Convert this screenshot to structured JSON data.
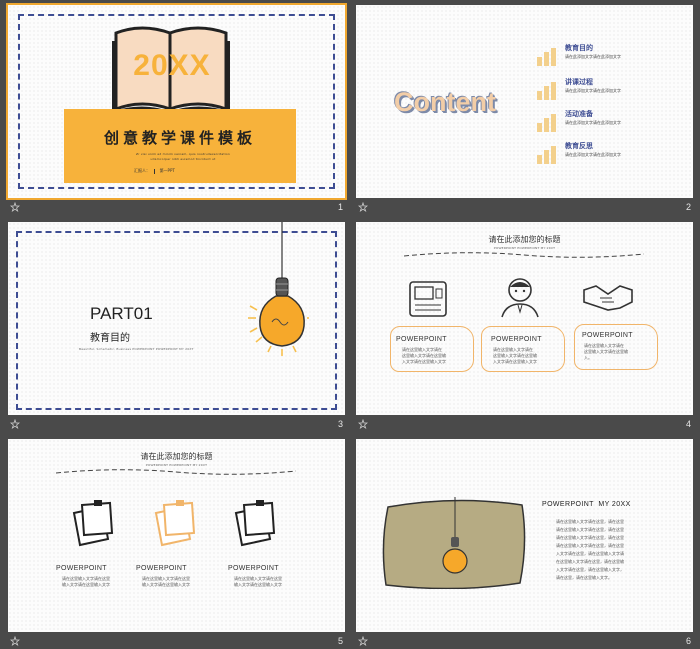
{
  "slides": [
    {
      "number": "1",
      "book_year": "20XX",
      "title": "创意教学课件模板",
      "subtitle_lines": [
        "Zr visi unim ad minim veniam, quis nostrudexercitation",
        "ullamcorper nibh euismod tincidunt ut"
      ],
      "presenter": "汇报人：",
      "presenter_name": "第一PPT"
    },
    {
      "number": "2",
      "content_word": "Content",
      "items": [
        {
          "title": "教育目的",
          "desc": "请在此添加文字请在此添加文字"
        },
        {
          "title": "讲课过程",
          "desc": "请在此添加文字请在此添加文字"
        },
        {
          "title": "活动准备",
          "desc": "请在此添加文字请在此添加文字"
        },
        {
          "title": "教育反思",
          "desc": "请在此添加文字请在此添加文字"
        }
      ]
    },
    {
      "number": "3",
      "part": "PART01",
      "part_title": "教育目的",
      "part_sub": "Beautiful, Schematic, Business POWERPOINT POWERPOINT MY 20XT"
    },
    {
      "number": "4",
      "heading": "请在此添加您的标题",
      "heading_sub": "POWERPOINT POWERPOINT MY 20XT",
      "cards": [
        {
          "label": "POWERPOINT",
          "lines": [
            "请在这里输入文字请在",
            "这里输入文字请在这里输",
            "入文字请在这里输入文字"
          ]
        },
        {
          "label": "POWERPOINT",
          "lines": [
            "请在这里输入文字请在",
            "这里输入文字请在这里输",
            "入文字请在这里输入文字"
          ]
        },
        {
          "label": "POWERPOINT",
          "lines": [
            "请在这里输入文字请在",
            "这里输入文字请在这里输",
            "入。"
          ]
        }
      ]
    },
    {
      "number": "5",
      "heading": "请在此添加您的标题",
      "heading_sub": "POWERPOINT POWERPOINT MY 20XT",
      "columns": [
        {
          "label": "POWERPOINT",
          "lines": [
            "请在这里输入文字请在这里",
            "输入文字请在这里输入文字"
          ]
        },
        {
          "label": "POWERPOINT",
          "lines": [
            "请在这里输入文字请在这里",
            "输入文字请在这里输入文字"
          ]
        },
        {
          "label": "POWERPOINT",
          "lines": [
            "请在这里输入文字请在这里",
            "输入文字请在这里输入文字"
          ]
        }
      ]
    },
    {
      "number": "6",
      "title": "POWERPOINT  MY 20XX",
      "lines": [
        "请在这里输入文字请在这里，请在这里",
        "请在这里输入文字请在这里，请在这里",
        "请在这里输入文字请在这里，请在这里",
        "请在这里输入文字请在这里，请在这里",
        "入文字请在这里，请在这里输入文字请",
        "在这里输入文字请在这里，请在这里输",
        "入文字请在这里，请在这里输入文字，",
        "请在这里，请在这里输入文字。"
      ]
    }
  ],
  "colors": {
    "accent": "#f7b23b",
    "frame": "#3e4d93",
    "panel": "#b6ab83",
    "background": "#4a4a4a"
  },
  "icons": {
    "slide_footer": "star-icon"
  }
}
